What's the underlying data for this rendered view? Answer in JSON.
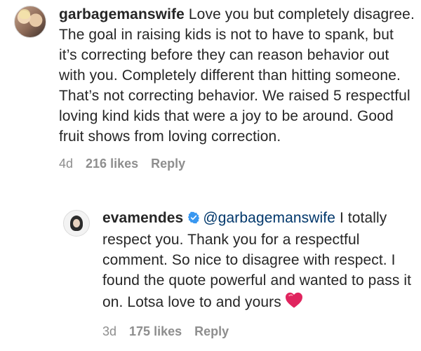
{
  "comments": [
    {
      "avatar_icon": "profile-photo-icon",
      "username": "garbagemanswife",
      "text": "Love you but completely disagree. The goal in raising kids is not to have to spank, but it’s correcting before they can reason behavior out with you. Completely different than hitting someone. That’s not correcting behavior. We raised 5 respectful loving kind kids that were a joy to be around. Good fruit shows from loving correction.",
      "time": "4d",
      "likes": "216 likes",
      "reply_label": "Reply"
    },
    {
      "avatar_icon": "profile-photo-icon",
      "username": "evamendes",
      "verified_icon": "verified-badge-icon",
      "mention": "@garbagemanswife",
      "text": "I totally respect you. Thank you for a respectful comment. So nice to disagree with respect. I found the quote powerful and wanted to pass it on. Lotsa love to and yours",
      "emoji_icon": "red-heart-icon",
      "time": "3d",
      "likes": "175 likes",
      "reply_label": "Reply"
    }
  ],
  "colors": {
    "text": "#262626",
    "meta": "#8e8e8e",
    "verified": "#3897f0",
    "mention": "#00376b",
    "heart": "#e0245e"
  }
}
